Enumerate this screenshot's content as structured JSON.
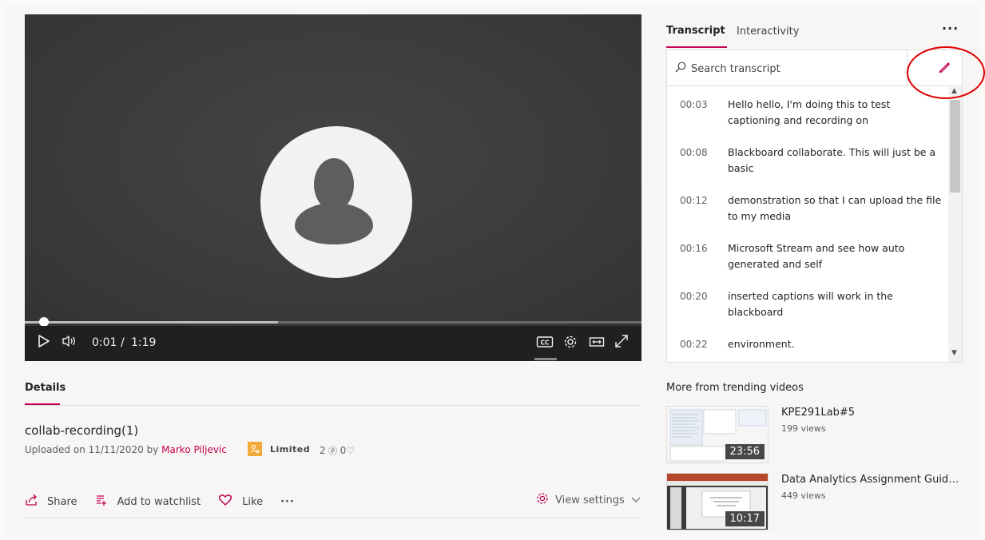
{
  "player": {
    "current_time": "0:01",
    "separator": "/",
    "duration": "1:19",
    "progress_fraction": 0.023,
    "buffered_fraction": 0.41,
    "icons": [
      "play-icon",
      "volume-icon",
      "closed-captions-icon",
      "settings-icon",
      "theater-mode-icon",
      "fullscreen-icon"
    ]
  },
  "details": {
    "tab_label": "Details",
    "title": "collab-recording(1)",
    "uploaded_prefix": "Uploaded on 11/11/2020 by",
    "uploader": "Marko Piljevic",
    "permission": "Limited",
    "views_count": "2",
    "likes_count": "0"
  },
  "actions": {
    "share": "Share",
    "watchlist": "Add to watchlist",
    "like": "Like",
    "more": "···",
    "view_settings": "View settings"
  },
  "panel": {
    "tab_transcript": "Transcript",
    "tab_interactivity": "Interactivity",
    "more": "···",
    "search_placeholder": "Search transcript"
  },
  "transcript": [
    {
      "time": "00:03",
      "text": "Hello hello, I'm doing this to test captioning and recording on"
    },
    {
      "time": "00:08",
      "text": "Blackboard collaborate. This will just be a basic"
    },
    {
      "time": "00:12",
      "text": "demonstration so that I can upload the file to my media"
    },
    {
      "time": "00:16",
      "text": "Microsoft Stream and see how auto generated and self"
    },
    {
      "time": "00:20",
      "text": "inserted captions will work in the blackboard"
    },
    {
      "time": "00:22",
      "text": "environment."
    }
  ],
  "trending": {
    "title": "More from trending videos",
    "videos": [
      {
        "title": "KPE291Lab#5",
        "views": "199 views",
        "duration": "23:56"
      },
      {
        "title": "Data Analytics Assignment Guidelines",
        "views": "449 views",
        "duration": "10:17"
      }
    ]
  },
  "colors": {
    "accent": "#c30052",
    "highlight_ring": "#e00000",
    "player_bg": "#3b3b3b",
    "controls_bg": "#202020"
  }
}
